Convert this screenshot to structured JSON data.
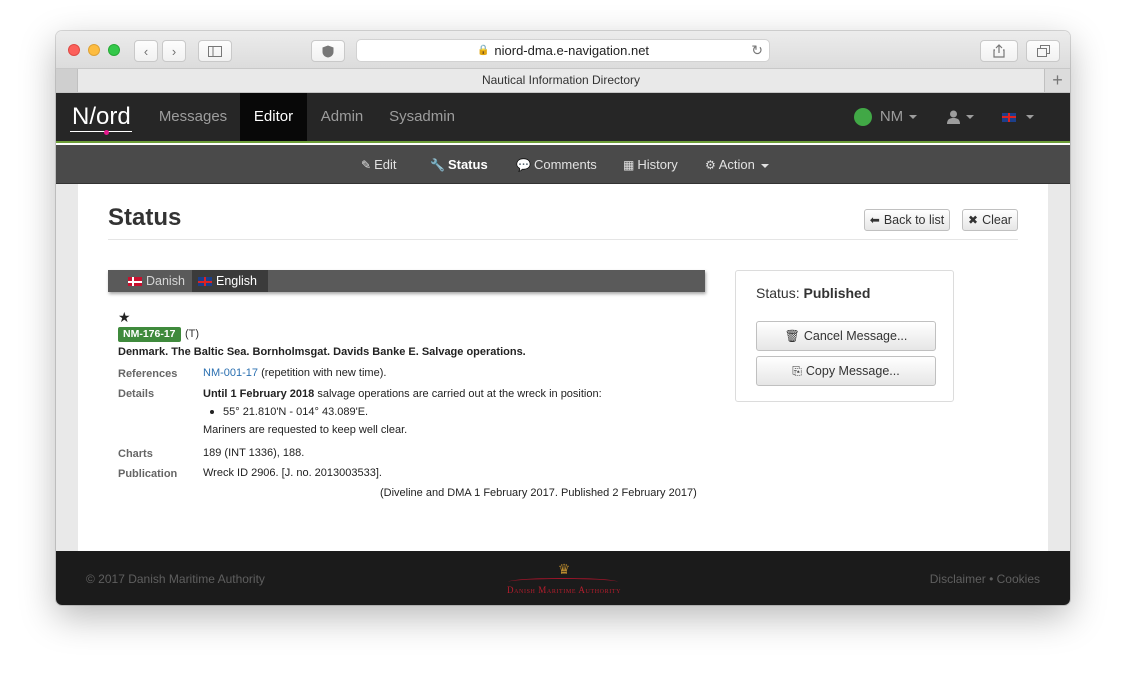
{
  "browser": {
    "url": "niord-dma.e-navigation.net",
    "tab_title": "Nautical Information Directory"
  },
  "app": {
    "logo": "Niord",
    "nav": [
      "Messages",
      "Editor",
      "Admin",
      "Sysadmin"
    ],
    "active_nav": "Editor",
    "user_label": "NM",
    "status_color": "#41a846"
  },
  "subnav": {
    "items": [
      "Edit",
      "Status",
      "Comments",
      "History",
      "Action"
    ],
    "active": "Status"
  },
  "page": {
    "title": "Status",
    "back_button": "Back to list",
    "clear_button": "Clear"
  },
  "languages": {
    "tabs": [
      "Danish",
      "English"
    ],
    "active": "English"
  },
  "message": {
    "star": "★",
    "id": "NM-176-17",
    "id_suffix": "(T)",
    "title": "Denmark. The Baltic Sea. Bornholmsgat. Davids Banke E. Salvage operations.",
    "references_label": "References",
    "references_link": "NM-001-17",
    "references_note": "(repetition with new time).",
    "details_label": "Details",
    "details_bold": "Until 1 February 2018",
    "details_text": " salvage operations are carried out at the wreck in position:",
    "details_bullet": "55° 21.810'N - 014° 43.089'E.",
    "details_note": "Mariners are requested to keep well clear.",
    "charts_label": "Charts",
    "charts_value": "189 (INT 1336), 188.",
    "publication_label": "Publication",
    "publication_value": "Wreck ID 2906. [J. no. 2013003533].",
    "source": "(Diveline and DMA 1 February 2017. Published 2 February 2017)"
  },
  "status_panel": {
    "label": "Status:",
    "value": "Published",
    "cancel_button": "Cancel Message...",
    "copy_button": "Copy Message..."
  },
  "footer": {
    "copyright": "© 2017 Danish Maritime Authority",
    "dma_logo_text": "Danish Maritime Authority",
    "links": [
      "Disclaimer",
      "Cookies"
    ],
    "separator": "•"
  }
}
